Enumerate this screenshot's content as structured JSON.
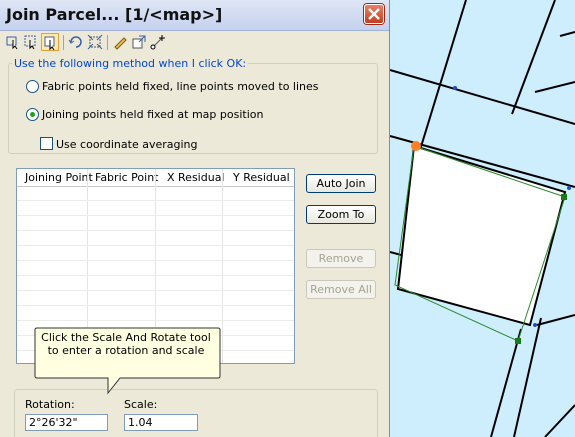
{
  "dialog": {
    "title": "Join Parcel... [1/<map>]",
    "method_group": {
      "legend": "Use the following method when I click OK:",
      "option_fabric": "Fabric points held fixed, line points moved to lines",
      "option_joining": "Joining points held fixed at map position",
      "selected_option": "option_joining",
      "coordinate_averaging_label": "Use coordinate averaging",
      "coordinate_averaging_checked": false
    },
    "table": {
      "columns": [
        "Joining Point",
        "Fabric Point",
        "X Residual",
        "Y Residual"
      ],
      "rows": []
    },
    "buttons": {
      "auto_join": "Auto Join",
      "zoom_to": "Zoom To",
      "remove": "Remove",
      "remove_all": "Remove All"
    },
    "callout": {
      "text": "Click the Scale And Rotate tool  to enter a rotation and scale"
    },
    "rotation": {
      "label": "Rotation:",
      "value": "2°26'32\""
    },
    "scale": {
      "label": "Scale:",
      "value": "1.04"
    },
    "toolbar": [
      "select-points-icon",
      "select-lines-icon",
      "scale-rotate-icon",
      "rotate-icon",
      "scale-icon",
      "edit-pencil-icon",
      "resize-icon",
      "move-points-icon"
    ]
  },
  "colors": {
    "map_background": "#cfeefd",
    "parcel_fill": "#ffffff",
    "parcel_outline": "#2a8a2a",
    "callout_fill": "#ffffe1",
    "point_highlight": "#ff7f27"
  }
}
